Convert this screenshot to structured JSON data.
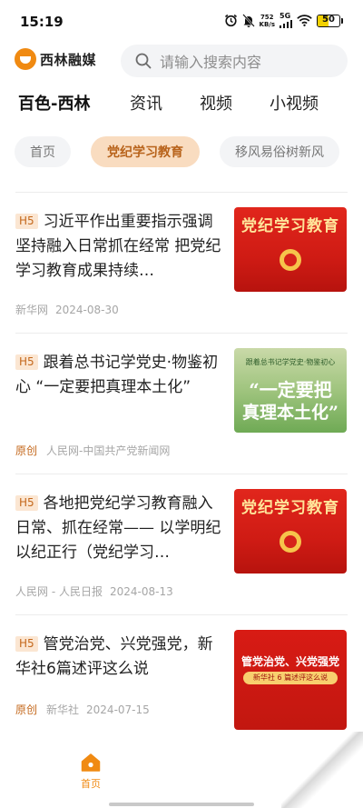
{
  "status_bar": {
    "time": "15:19",
    "net_speed_value": "752",
    "net_speed_unit": "KB/s",
    "network": "5G",
    "battery": "50",
    "icons": [
      "alarm-icon",
      "mute-icon",
      "signal-icon",
      "wifi-icon",
      "battery-icon"
    ]
  },
  "header": {
    "logo_text": "西林融媒",
    "search_placeholder": "请输入搜索内容"
  },
  "channels": [
    "百色-西林",
    "资讯",
    "视频",
    "小视频"
  ],
  "subtabs": [
    "首页",
    "党纪学习教育",
    "移风易俗树新风"
  ],
  "articles": [
    {
      "badge": "H5",
      "title": "习近平作出重要指示强调 坚持融入日常抓在经常 把党纪学习教育成果持续…",
      "tag": "",
      "source": "新华网",
      "date": "2024-08-30",
      "thumb_title": "党纪学习教育"
    },
    {
      "badge": "H5",
      "title": "跟着总书记学党史·物鉴初心 “一定要把真理本土化”",
      "tag": "原创",
      "source": "人民网-中国共产党新闻网",
      "date": "",
      "thumb_sub": "跟着总书记学党史·物鉴初心",
      "thumb_line1": "“一定要把",
      "thumb_line2": "真理本土化”"
    },
    {
      "badge": "H5",
      "title": "各地把党纪学习教育融入日常、抓在经常—— 以学明纪 以纪正行（党纪学习…",
      "tag": "",
      "source": "人民网 - 人民日报",
      "date": "2024-08-13",
      "thumb_title": "党纪学习教育"
    },
    {
      "badge": "H5",
      "title": "管党治党、兴党强党，新华社6篇述评这么说",
      "tag": "原创",
      "source": "新华社",
      "date": "2024-07-15",
      "thumb_a": "管党治党、兴党强党",
      "thumb_b": "新华社 6 篇述评这么说"
    }
  ],
  "bottom_nav": {
    "home_label": "首页"
  },
  "colors": {
    "accent": "#f08a12",
    "chip_active_bg": "#f9dcc0",
    "chip_active_text": "#b8631b",
    "meta_gray": "#a6a6a6",
    "thumb_red": "#d6221a"
  }
}
